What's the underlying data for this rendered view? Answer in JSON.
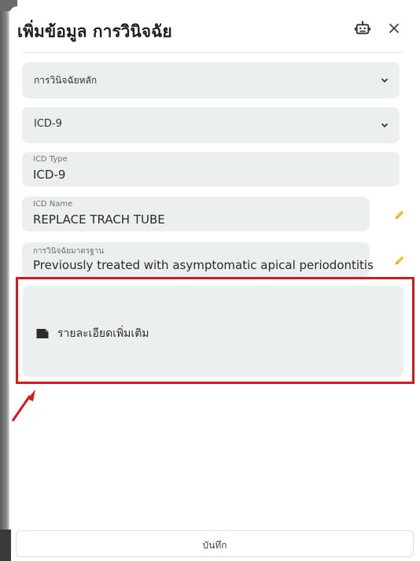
{
  "dialog": {
    "title": "เพิ่มข้อมูล การวินิจฉัย",
    "icons": {
      "assistant": "robot-icon",
      "close": "close-icon"
    }
  },
  "form": {
    "diagnosis_type": {
      "selected": "การวินิจฉัยหลัก",
      "icon": "chevron-down-icon"
    },
    "icd_version": {
      "selected": "ICD-9",
      "icon": "chevron-down-icon"
    },
    "icd_type": {
      "label": "ICD Type",
      "value": "ICD-9"
    },
    "icd_name": {
      "label": "ICD Name",
      "value": "REPLACE TRACH TUBE",
      "edit_icon": "pencil-icon"
    },
    "standard_diagnosis": {
      "label": "การวินิจฉัยมาตรฐาน",
      "value": "Previously treated with asymptomatic apical periodontitis",
      "edit_icon": "pencil-icon"
    },
    "additional_details": {
      "label": "รายละเอียดเพิ่มเติม",
      "icon": "note-icon"
    }
  },
  "footer": {
    "save_label": "บันทึก"
  },
  "annotation": {
    "highlight_color": "#d7191c",
    "arrow_color": "#d7191c"
  },
  "colors": {
    "field_background": "#eceff0",
    "edit_icon": "#e8c52a"
  }
}
